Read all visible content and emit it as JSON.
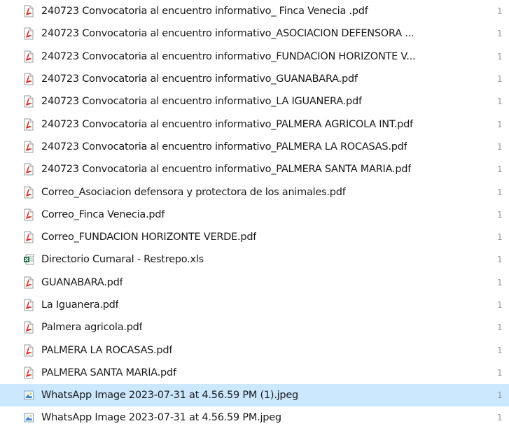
{
  "files": [
    {
      "name": "240723 Convocatoria al encuentro informativo_ Finca Venecia  .pdf",
      "icon": "pdf-icon",
      "tail": "1"
    },
    {
      "name": "240723 Convocatoria al encuentro informativo_ASOCIACION DEFENSORA ...",
      "icon": "pdf-icon",
      "tail": "1"
    },
    {
      "name": "240723 Convocatoria al encuentro informativo_FUNDACIÓN HORIZONTE V...",
      "icon": "pdf-icon",
      "tail": "1"
    },
    {
      "name": "240723 Convocatoria al encuentro informativo_GUANABARA.pdf",
      "icon": "pdf-icon",
      "tail": "1"
    },
    {
      "name": "240723 Convocatoria al encuentro informativo_LA IGUANERA.pdf",
      "icon": "pdf-icon",
      "tail": "1"
    },
    {
      "name": "240723 Convocatoria al encuentro informativo_PALMERA AGRÍCOLA INT.pdf",
      "icon": "pdf-icon",
      "tail": "1"
    },
    {
      "name": "240723 Convocatoria al encuentro informativo_PALMERA LA ROCASAS.pdf",
      "icon": "pdf-icon",
      "tail": "1"
    },
    {
      "name": "240723 Convocatoria al encuentro informativo_PALMERA SANTA MARÍA.pdf",
      "icon": "pdf-icon",
      "tail": "1"
    },
    {
      "name": "Correo_Asociacion defensora y protectora de los animales.pdf",
      "icon": "pdf-icon",
      "tail": "1"
    },
    {
      "name": "Correo_Finca Venecia.pdf",
      "icon": "pdf-icon",
      "tail": "1"
    },
    {
      "name": "Correo_FUNDACIÓN HORIZONTE VERDE.pdf",
      "icon": "pdf-icon",
      "tail": "1"
    },
    {
      "name": "Directorio Cumaral - Restrepo.xls",
      "icon": "excel-icon",
      "tail": "1"
    },
    {
      "name": "GUANABARA.pdf",
      "icon": "pdf-icon",
      "tail": "1"
    },
    {
      "name": "La Iguanera.pdf",
      "icon": "pdf-icon",
      "tail": "1"
    },
    {
      "name": "Palmera agricola.pdf",
      "icon": "pdf-icon",
      "tail": "1"
    },
    {
      "name": "PALMERA LA ROCASAS.pdf",
      "icon": "pdf-icon",
      "tail": "1"
    },
    {
      "name": "PALMERA SANTA MARÍA.pdf",
      "icon": "pdf-icon",
      "tail": "1"
    },
    {
      "name": "WhatsApp Image 2023-07-31 at 4.56.59 PM (1).jpeg",
      "icon": "image-icon",
      "tail": "1",
      "selected": true
    },
    {
      "name": "WhatsApp Image 2023-07-31 at 4.56.59 PM.jpeg",
      "icon": "image-icon",
      "tail": "1"
    }
  ],
  "colors": {
    "selection": "#cce8ff",
    "pdf_red": "#d9261c",
    "excel_green": "#1d7044",
    "image_blue": "#3d7fc8"
  }
}
